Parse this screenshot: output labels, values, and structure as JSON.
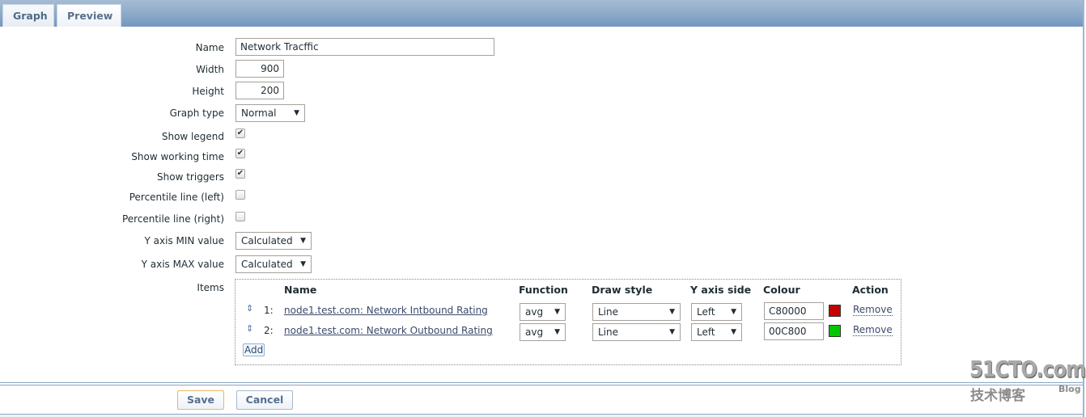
{
  "tabs": [
    {
      "label": "Graph",
      "active": true
    },
    {
      "label": "Preview",
      "active": false
    }
  ],
  "form": {
    "name": {
      "label": "Name",
      "value": "Network Tracffic"
    },
    "width": {
      "label": "Width",
      "value": "900"
    },
    "height": {
      "label": "Height",
      "value": "200"
    },
    "graph_type": {
      "label": "Graph type",
      "value": "Normal"
    },
    "show_legend": {
      "label": "Show legend",
      "checked": true
    },
    "show_working_time": {
      "label": "Show working time",
      "checked": true
    },
    "show_triggers": {
      "label": "Show triggers",
      "checked": true
    },
    "percentile_left": {
      "label": "Percentile line (left)",
      "checked": false
    },
    "percentile_right": {
      "label": "Percentile line (right)",
      "checked": false
    },
    "y_min": {
      "label": "Y axis MIN value",
      "value": "Calculated"
    },
    "y_max": {
      "label": "Y axis MAX value",
      "value": "Calculated"
    },
    "items_label": "Items"
  },
  "items": {
    "headers": {
      "name": "Name",
      "function": "Function",
      "draw_style": "Draw style",
      "y_axis_side": "Y axis side",
      "colour": "Colour",
      "action": "Action"
    },
    "rows": [
      {
        "num": "1:",
        "name": "node1.test.com: Network Intbound Rating",
        "function": "avg",
        "draw_style": "Line",
        "y_axis_side": "Left",
        "colour": "C80000",
        "swatch": "#c80000",
        "action": "Remove"
      },
      {
        "num": "2:",
        "name": "node1.test.com: Network Outbound Rating",
        "function": "avg",
        "draw_style": "Line",
        "y_axis_side": "Left",
        "colour": "00C800",
        "swatch": "#00c800",
        "action": "Remove"
      }
    ],
    "add_label": "Add"
  },
  "buttons": {
    "save": "Save",
    "cancel": "Cancel"
  },
  "watermark": {
    "top": "51CTO.com",
    "bottom": "技术博客",
    "blog": "Blog"
  },
  "icons": {
    "dropdown": "▼",
    "check": "✔",
    "drag": "⇕"
  }
}
